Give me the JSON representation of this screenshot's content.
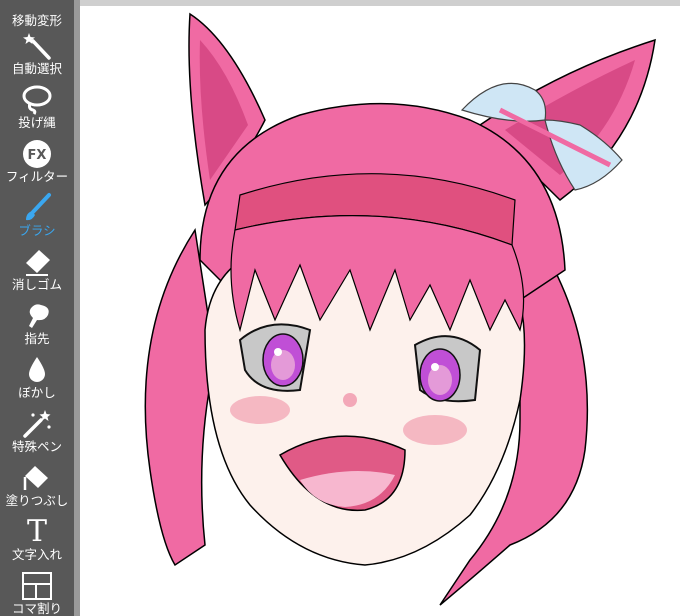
{
  "toolbar": {
    "tools": [
      {
        "label": "移動変形",
        "icon": "move-transform-icon"
      },
      {
        "label": "自動選択",
        "icon": "magic-wand-icon"
      },
      {
        "label": "投げ縄",
        "icon": "lasso-icon"
      },
      {
        "label": "フィルター",
        "icon": "fx-filter-icon",
        "icon_text": "FX"
      },
      {
        "label": "ブラシ",
        "icon": "brush-icon",
        "active": true
      },
      {
        "label": "消しゴム",
        "icon": "eraser-icon"
      },
      {
        "label": "指先",
        "icon": "finger-smudge-icon"
      },
      {
        "label": "ぼかし",
        "icon": "blur-drop-icon"
      },
      {
        "label": "特殊ペン",
        "icon": "special-pen-icon"
      },
      {
        "label": "塗りつぶし",
        "icon": "fill-bucket-icon"
      },
      {
        "label": "文字入れ",
        "icon": "text-tool-icon",
        "icon_text": "T"
      },
      {
        "label": "コマ割り",
        "icon": "panel-divide-icon"
      }
    ]
  },
  "colors": {
    "toolbar_bg": "#585858",
    "active_tool": "#3aa7f0",
    "hair": "#f06aa3",
    "hair_shadow": "#d84a86",
    "skin": "#fdf1ec",
    "eye": "#c04fd6",
    "ribbon": "#cfe6f5"
  }
}
